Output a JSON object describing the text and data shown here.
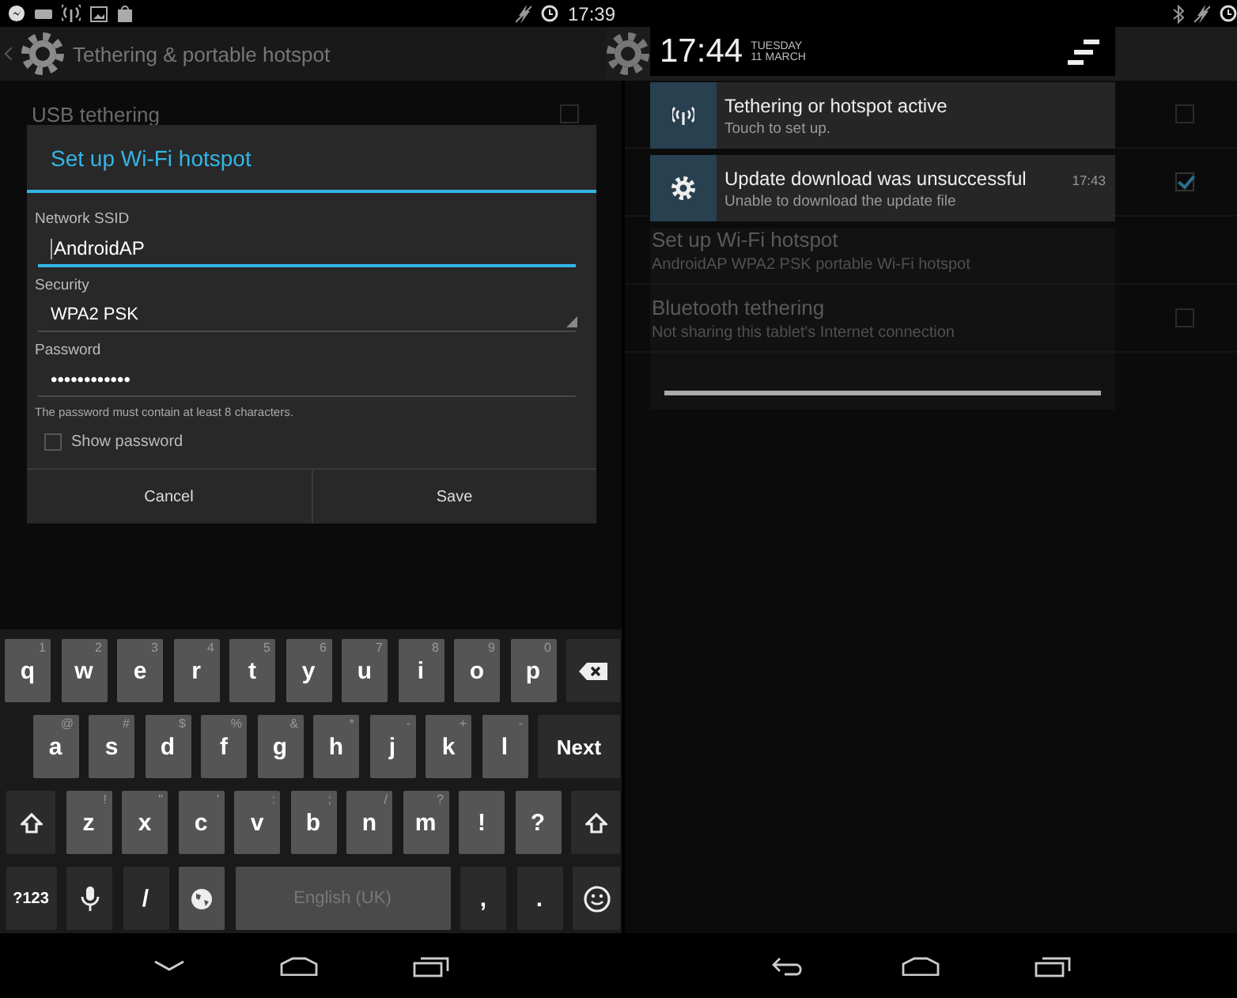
{
  "left_screen": {
    "status_bar": {
      "time": "17:39"
    },
    "action_bar": {
      "title": "Tethering & portable hotspot"
    },
    "background_settings": [
      {
        "title": "USB tethering",
        "checked": false
      }
    ],
    "dialog": {
      "title": "Set up Wi-Fi hotspot",
      "fields": [
        {
          "kind": "text",
          "label": "Network SSID",
          "value": "AndroidAP",
          "focused": true
        },
        {
          "kind": "select",
          "label": "Security",
          "value": "WPA2 PSK"
        },
        {
          "kind": "text",
          "label": "Password",
          "value": "••••••••••••",
          "focused": false
        }
      ],
      "hint": "The password must contain at least 8 characters.",
      "show_password": {
        "label": "Show password",
        "checked": false
      },
      "buttons": [
        "Cancel",
        "Save"
      ]
    },
    "keyboard": {
      "key_rows": [
        {
          "keys": [
            {
              "kind": "char",
              "label": "q",
              "hint": "1"
            },
            {
              "kind": "char",
              "label": "w",
              "hint": "2"
            },
            {
              "kind": "char",
              "label": "e",
              "hint": "3"
            },
            {
              "kind": "char",
              "label": "r",
              "hint": "4"
            },
            {
              "kind": "char",
              "label": "t",
              "hint": "5"
            },
            {
              "kind": "char",
              "label": "y",
              "hint": "6"
            },
            {
              "kind": "char",
              "label": "u",
              "hint": "7"
            },
            {
              "kind": "char",
              "label": "i",
              "hint": "8"
            },
            {
              "kind": "char",
              "label": "o",
              "hint": "9"
            },
            {
              "kind": "char",
              "label": "p",
              "hint": "0"
            },
            {
              "kind": "backspace"
            }
          ]
        },
        {
          "keys": [
            {
              "kind": "char",
              "label": "a",
              "hint": "@"
            },
            {
              "kind": "char",
              "label": "s",
              "hint": "#"
            },
            {
              "kind": "char",
              "label": "d",
              "hint": "$"
            },
            {
              "kind": "char",
              "label": "f",
              "hint": "%"
            },
            {
              "kind": "char",
              "label": "g",
              "hint": "&"
            },
            {
              "kind": "char",
              "label": "h",
              "hint": "*"
            },
            {
              "kind": "char",
              "label": "j",
              "hint": "-"
            },
            {
              "kind": "char",
              "label": "k",
              "hint": "+"
            },
            {
              "kind": "char",
              "label": "l",
              "hint": "-"
            },
            {
              "kind": "action",
              "label": "Next"
            }
          ]
        },
        {
          "keys": [
            {
              "kind": "shift"
            },
            {
              "kind": "char",
              "label": "z",
              "hint": "!"
            },
            {
              "kind": "char",
              "label": "x",
              "hint": "\""
            },
            {
              "kind": "char",
              "label": "c",
              "hint": "'"
            },
            {
              "kind": "char",
              "label": "v",
              "hint": ":"
            },
            {
              "kind": "char",
              "label": "b",
              "hint": ";"
            },
            {
              "kind": "char",
              "label": "n",
              "hint": "/"
            },
            {
              "kind": "char",
              "label": "m",
              "hint": "?"
            },
            {
              "kind": "char",
              "label": "!"
            },
            {
              "kind": "char",
              "label": "?"
            },
            {
              "kind": "shift"
            }
          ]
        },
        {
          "keys": [
            {
              "kind": "function",
              "label": "?123"
            },
            {
              "kind": "mic"
            },
            {
              "kind": "dark_char",
              "label": "/"
            },
            {
              "kind": "globe"
            },
            {
              "kind": "space",
              "label": "English (UK)"
            },
            {
              "kind": "dark_char",
              "label": ","
            },
            {
              "kind": "dark_char",
              "label": "."
            },
            {
              "kind": "emoji"
            }
          ]
        }
      ]
    }
  },
  "right_screen": {
    "background_settings": [
      {
        "checked": false
      },
      {
        "checked": true
      },
      {
        "title": "Set up Wi-Fi hotspot",
        "subtitle": "AndroidAP WPA2 PSK portable Wi-Fi hotspot"
      },
      {
        "title": "Bluetooth tethering",
        "subtitle": "Not sharing this tablet's Internet connection",
        "checked": false
      }
    ],
    "notification_shade": {
      "time": "17:44",
      "day": "TUESDAY",
      "date": "11 MARCH",
      "notifications": [
        {
          "kind": "hotspot",
          "title": "Tethering or hotspot active",
          "text": "Touch to set up."
        },
        {
          "kind": "settings",
          "title": "Update download was unsuccessful",
          "text": "Unable to download the update file",
          "time": "17:43"
        }
      ]
    }
  }
}
